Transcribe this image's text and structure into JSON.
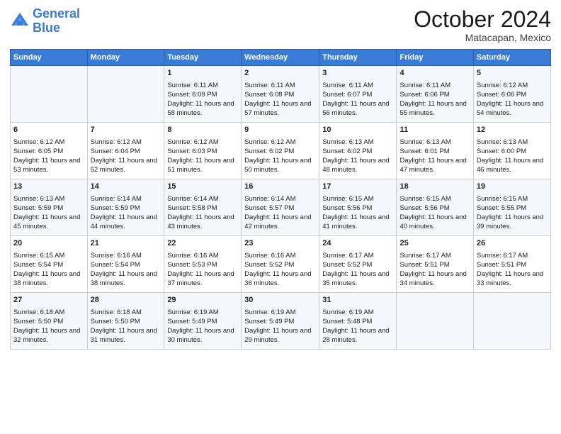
{
  "logo": {
    "line1": "General",
    "line2": "Blue"
  },
  "title": "October 2024",
  "subtitle": "Matacapan, Mexico",
  "weekdays": [
    "Sunday",
    "Monday",
    "Tuesday",
    "Wednesday",
    "Thursday",
    "Friday",
    "Saturday"
  ],
  "weeks": [
    [
      {
        "day": "",
        "text": ""
      },
      {
        "day": "",
        "text": ""
      },
      {
        "day": "1",
        "text": "Sunrise: 6:11 AM\nSunset: 6:09 PM\nDaylight: 11 hours and 58 minutes."
      },
      {
        "day": "2",
        "text": "Sunrise: 6:11 AM\nSunset: 6:08 PM\nDaylight: 11 hours and 57 minutes."
      },
      {
        "day": "3",
        "text": "Sunrise: 6:11 AM\nSunset: 6:07 PM\nDaylight: 11 hours and 56 minutes."
      },
      {
        "day": "4",
        "text": "Sunrise: 6:11 AM\nSunset: 6:06 PM\nDaylight: 11 hours and 55 minutes."
      },
      {
        "day": "5",
        "text": "Sunrise: 6:12 AM\nSunset: 6:06 PM\nDaylight: 11 hours and 54 minutes."
      }
    ],
    [
      {
        "day": "6",
        "text": "Sunrise: 6:12 AM\nSunset: 6:05 PM\nDaylight: 11 hours and 53 minutes."
      },
      {
        "day": "7",
        "text": "Sunrise: 6:12 AM\nSunset: 6:04 PM\nDaylight: 11 hours and 52 minutes."
      },
      {
        "day": "8",
        "text": "Sunrise: 6:12 AM\nSunset: 6:03 PM\nDaylight: 11 hours and 51 minutes."
      },
      {
        "day": "9",
        "text": "Sunrise: 6:12 AM\nSunset: 6:02 PM\nDaylight: 11 hours and 50 minutes."
      },
      {
        "day": "10",
        "text": "Sunrise: 6:13 AM\nSunset: 6:02 PM\nDaylight: 11 hours and 48 minutes."
      },
      {
        "day": "11",
        "text": "Sunrise: 6:13 AM\nSunset: 6:01 PM\nDaylight: 11 hours and 47 minutes."
      },
      {
        "day": "12",
        "text": "Sunrise: 6:13 AM\nSunset: 6:00 PM\nDaylight: 11 hours and 46 minutes."
      }
    ],
    [
      {
        "day": "13",
        "text": "Sunrise: 6:13 AM\nSunset: 5:59 PM\nDaylight: 11 hours and 45 minutes."
      },
      {
        "day": "14",
        "text": "Sunrise: 6:14 AM\nSunset: 5:59 PM\nDaylight: 11 hours and 44 minutes."
      },
      {
        "day": "15",
        "text": "Sunrise: 6:14 AM\nSunset: 5:58 PM\nDaylight: 11 hours and 43 minutes."
      },
      {
        "day": "16",
        "text": "Sunrise: 6:14 AM\nSunset: 5:57 PM\nDaylight: 11 hours and 42 minutes."
      },
      {
        "day": "17",
        "text": "Sunrise: 6:15 AM\nSunset: 5:56 PM\nDaylight: 11 hours and 41 minutes."
      },
      {
        "day": "18",
        "text": "Sunrise: 6:15 AM\nSunset: 5:56 PM\nDaylight: 11 hours and 40 minutes."
      },
      {
        "day": "19",
        "text": "Sunrise: 6:15 AM\nSunset: 5:55 PM\nDaylight: 11 hours and 39 minutes."
      }
    ],
    [
      {
        "day": "20",
        "text": "Sunrise: 6:15 AM\nSunset: 5:54 PM\nDaylight: 11 hours and 38 minutes."
      },
      {
        "day": "21",
        "text": "Sunrise: 6:16 AM\nSunset: 5:54 PM\nDaylight: 11 hours and 38 minutes."
      },
      {
        "day": "22",
        "text": "Sunrise: 6:16 AM\nSunset: 5:53 PM\nDaylight: 11 hours and 37 minutes."
      },
      {
        "day": "23",
        "text": "Sunrise: 6:16 AM\nSunset: 5:52 PM\nDaylight: 11 hours and 36 minutes."
      },
      {
        "day": "24",
        "text": "Sunrise: 6:17 AM\nSunset: 5:52 PM\nDaylight: 11 hours and 35 minutes."
      },
      {
        "day": "25",
        "text": "Sunrise: 6:17 AM\nSunset: 5:51 PM\nDaylight: 11 hours and 34 minutes."
      },
      {
        "day": "26",
        "text": "Sunrise: 6:17 AM\nSunset: 5:51 PM\nDaylight: 11 hours and 33 minutes."
      }
    ],
    [
      {
        "day": "27",
        "text": "Sunrise: 6:18 AM\nSunset: 5:50 PM\nDaylight: 11 hours and 32 minutes."
      },
      {
        "day": "28",
        "text": "Sunrise: 6:18 AM\nSunset: 5:50 PM\nDaylight: 11 hours and 31 minutes."
      },
      {
        "day": "29",
        "text": "Sunrise: 6:19 AM\nSunset: 5:49 PM\nDaylight: 11 hours and 30 minutes."
      },
      {
        "day": "30",
        "text": "Sunrise: 6:19 AM\nSunset: 5:49 PM\nDaylight: 11 hours and 29 minutes."
      },
      {
        "day": "31",
        "text": "Sunrise: 6:19 AM\nSunset: 5:48 PM\nDaylight: 11 hours and 28 minutes."
      },
      {
        "day": "",
        "text": ""
      },
      {
        "day": "",
        "text": ""
      }
    ]
  ]
}
